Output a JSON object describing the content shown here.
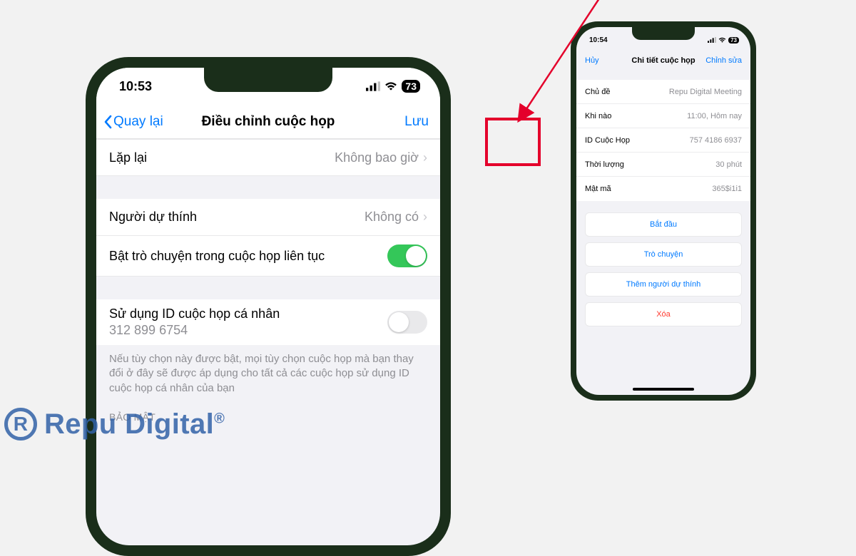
{
  "left": {
    "status": {
      "time": "10:53",
      "battery": "73"
    },
    "nav": {
      "back": "Quay lại",
      "title": "Điều chỉnh cuộc họp",
      "save": "Lưu"
    },
    "repeat_row": {
      "label": "Lặp lại",
      "value": "Không bao giờ"
    },
    "attendees_row": {
      "label": "Người dự thính",
      "value": "Không có"
    },
    "chat_row": {
      "label": "Bật trò chuyện trong cuộc họp liên tục"
    },
    "pmi_row": {
      "label": "Sử dụng ID cuộc họp cá nhân",
      "id": "312 899 6754"
    },
    "pmi_note": "Nếu tùy chọn này được bật, mọi tùy chọn cuộc họp mà bạn thay đổi ở đây sẽ được áp dụng cho tất cả các cuộc họp sử dụng ID cuộc họp cá nhân của bạn",
    "security_header": "BẢO MẬT"
  },
  "right": {
    "status": {
      "time": "10:54",
      "battery": "73"
    },
    "nav": {
      "cancel": "Hủy",
      "title": "Chi tiết cuộc họp",
      "edit": "Chỉnh sửa"
    },
    "rows": {
      "topic": {
        "label": "Chủ đề",
        "value": "Repu Digital Meeting"
      },
      "when": {
        "label": "Khi nào",
        "value": "11:00, Hôm nay"
      },
      "id": {
        "label": "ID Cuộc Họp",
        "value": "757 4186 6937"
      },
      "duration": {
        "label": "Thời lượng",
        "value": "30 phút"
      },
      "passcode": {
        "label": "Mật mã",
        "value": "365$i1i1"
      }
    },
    "actions": {
      "start": "Bắt đầu",
      "chat": "Trò chuyện",
      "add": "Thêm người dự thính",
      "delete": "Xóa"
    }
  },
  "watermark": "Repu Digital"
}
